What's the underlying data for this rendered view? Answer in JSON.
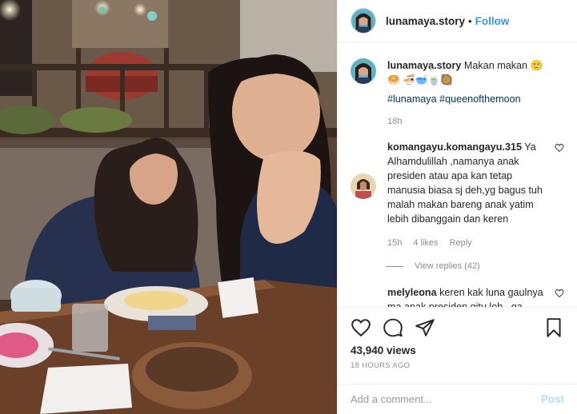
{
  "header": {
    "username": "lunamaya.story",
    "separator": "•",
    "follow_label": "Follow"
  },
  "caption": {
    "username": "lunamaya.story",
    "text": "Makan makan 🙂🥯 🍜🥣🍵🥘",
    "hashtags": "#lunamaya #queenofthemoon",
    "age": "18h"
  },
  "comments": [
    {
      "username": "komangayu.komangayu.315",
      "text": "Ya Alhamdulillah ,namanya anak presiden atau apa kan tetap manusia biasa sj deh,yg bagus tuh malah makan bareng anak yatim lebih dibanggain dan keren",
      "age": "15h",
      "likes": "4 likes",
      "reply_label": "Reply",
      "view_replies": "View replies (42)"
    },
    {
      "username": "melyleona",
      "text": "keren kak luna gaulnya ma anak presiden.gitu loh.. ga takut ah kata ...."
    }
  ],
  "stats": {
    "views": "43,940 views",
    "posted": "18 HOURS AGO"
  },
  "add_comment": {
    "placeholder": "Add a comment...",
    "post_label": "Post"
  },
  "colors": {
    "accent": "#3897f0",
    "post_disabled": "#b2dffc",
    "muted": "#8e8e8e",
    "hashtag": "#003569"
  },
  "icons": {
    "like": "heart-icon",
    "comment": "comment-icon",
    "share": "share-icon",
    "save": "bookmark-icon"
  }
}
